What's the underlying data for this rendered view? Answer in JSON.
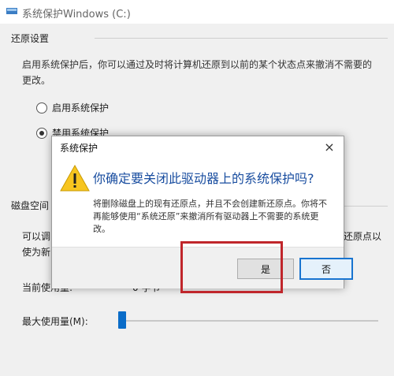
{
  "window": {
    "title": "系统保护Windows (C:)"
  },
  "restore_settings": {
    "group_label": "还原设置",
    "description": "启用系统保护后，你可以通过及时将计算机还原到以前的某个状态点来撤消不需要的更改。",
    "options": [
      {
        "label": "启用系统保护",
        "checked": false
      },
      {
        "label": "禁用系统保护",
        "checked": true
      }
    ]
  },
  "disk_space": {
    "group_label": "磁盘空间",
    "desc_left": "可以调\n使为新",
    "desc_right": "还原点以",
    "current_usage_label": "当前使用量:",
    "current_usage_value": "0 字节",
    "max_usage_label": "最大使用量(M):",
    "slider_fraction": 0.0
  },
  "dialog": {
    "title": "系统保护",
    "close_glyph": "×",
    "icon": "warning-icon",
    "main_instruction": "你确定要关闭此驱动器上的系统保护吗?",
    "detail": "将删除磁盘上的现有还原点，并且不会创建新还原点。你将不再能够使用“系统还原”来撤消所有驱动器上不需要的系统更改。",
    "yes_label": "是",
    "no_label": "否"
  },
  "colors": {
    "highlight": "#c0262b",
    "main_text": "#1a4ea0",
    "slider": "#0a6cc8"
  }
}
